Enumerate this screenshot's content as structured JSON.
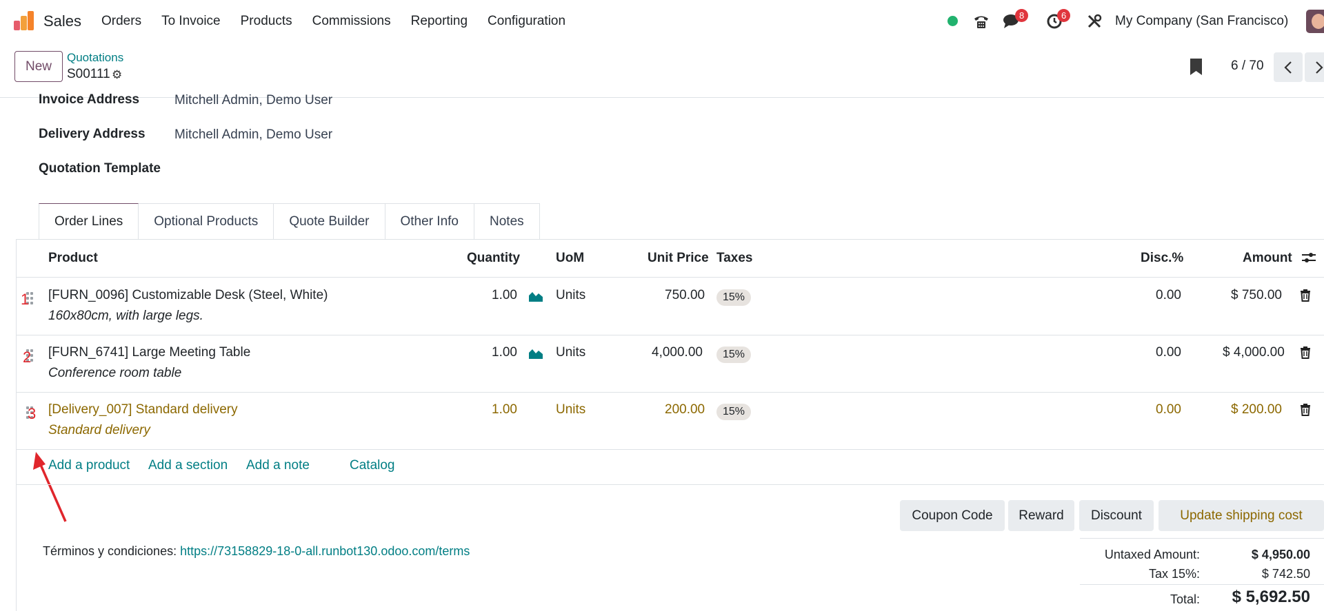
{
  "nav": {
    "app_name": "Sales",
    "menu": [
      "Orders",
      "To Invoice",
      "Products",
      "Commissions",
      "Reporting",
      "Configuration"
    ],
    "messages_count": "8",
    "activities_count": "6",
    "company": "My Company (San Francisco)"
  },
  "control_panel": {
    "new_label": "New",
    "breadcrumb_parent": "Quotations",
    "record_name": "S00111",
    "pager": "6 / 70"
  },
  "form": {
    "invoice_address_label": "Invoice Address",
    "invoice_address_value": "Mitchell Admin, Demo User",
    "delivery_address_label": "Delivery Address",
    "delivery_address_value": "Mitchell Admin, Demo User",
    "quotation_template_label": "Quotation Template"
  },
  "tabs": [
    "Order Lines",
    "Optional Products",
    "Quote Builder",
    "Other Info",
    "Notes"
  ],
  "table": {
    "headers": {
      "product": "Product",
      "quantity": "Quantity",
      "uom": "UoM",
      "unit_price": "Unit Price",
      "taxes": "Taxes",
      "disc": "Disc.%",
      "amount": "Amount"
    },
    "rows": [
      {
        "product": "[FURN_0096] Customizable Desk (Steel, White)",
        "description": "160x80cm, with large legs.",
        "quantity": "1.00",
        "uom": "Units",
        "unit_price": "750.00",
        "tax": "15%",
        "disc": "0.00",
        "amount": "$ 750.00"
      },
      {
        "product": "[FURN_6741] Large Meeting Table",
        "description": "Conference room table",
        "quantity": "1.00",
        "uom": "Units",
        "unit_price": "4,000.00",
        "tax": "15%",
        "disc": "0.00",
        "amount": "$ 4,000.00"
      },
      {
        "product": "[Delivery_007] Standard delivery",
        "description": "Standard delivery",
        "quantity": "1.00",
        "uom": "Units",
        "unit_price": "200.00",
        "tax": "15%",
        "disc": "0.00",
        "amount": "$ 200.00"
      }
    ],
    "add_links": {
      "product": "Add a product",
      "section": "Add a section",
      "note": "Add a note",
      "catalog": "Catalog"
    }
  },
  "annotations": [
    "1",
    "2",
    "3"
  ],
  "actions": {
    "coupon": "Coupon Code",
    "reward": "Reward",
    "discount": "Discount",
    "shipping": "Update shipping cost"
  },
  "terms": {
    "label": "Términos y condiciones:",
    "url": "https://73158829-18-0-all.runbot130.odoo.com/terms"
  },
  "totals": {
    "untaxed_label": "Untaxed Amount:",
    "untaxed_value": "$ 4,950.00",
    "tax_label": "Tax 15%:",
    "tax_value": "$ 742.50",
    "total_label": "Total:",
    "total_value": "$ 5,692.50"
  },
  "colors": {
    "brand": "#714b67",
    "link": "#017e84",
    "delivery_line": "#8c6800",
    "annotation": "#e0262c"
  }
}
